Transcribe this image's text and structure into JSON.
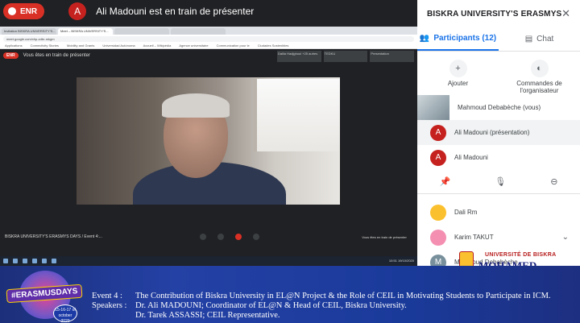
{
  "topbar": {
    "rec_label": "ENR",
    "presenter_initial": "A",
    "presenter_text": "Ali Madouni est en train de présenter"
  },
  "shared_screen": {
    "tabs": [
      "Invitation BISKRA UNIVERSITY'S...",
      "Meet – BISKRA UNIVERSITY'S...",
      "",
      ""
    ],
    "address": "meet.google.com/xhp-zdbr-mkgm",
    "bookmarks": [
      "Applications",
      "Connectivity Stories",
      "Mobility and Grants",
      "Universidad Autónoma",
      "Accueil – Wikipédia",
      "Agence universitaire",
      "Communication pour le",
      "Ciudades Sostenibles"
    ],
    "inner_rec": "ENR",
    "inner_presenting": "Vous êtes en train de présenter",
    "inner_tiles": [
      "Dalila Hadjghoul  +25 autres",
      "TEDKU",
      "Presentation"
    ],
    "bottom_title": "BISKRA UNIVERSITY'S ERASMYS DAYS / Event 4:...",
    "bottom_right": "Vous êtes en train de présenter",
    "taskbar_time": "10:51  19/10/2020"
  },
  "panel": {
    "title": "BISKRA UNIVERSITY'S ERASMYS D...",
    "tab_participants": "Participants (12)",
    "tab_chat": "Chat",
    "action_add": "Ajouter",
    "action_host": "Commandes de l'organisateur",
    "participants": [
      {
        "name": "Mahmoud Debabèche (vous)",
        "initial": "",
        "color": "#9e9e9e"
      },
      {
        "name": "Ali Madouni (présentation)",
        "initial": "A",
        "color": "#c5221f"
      },
      {
        "name": "Ali Madouni",
        "initial": "A",
        "color": "#c5221f"
      }
    ],
    "participants2": [
      {
        "name": "Dali Rm",
        "initial": "",
        "color": "#fbc02d"
      },
      {
        "name": "Karim TAKUT",
        "initial": "",
        "color": "#f48fb1"
      },
      {
        "name": "Mahmoud Debabèche",
        "initial": "M",
        "color": "#78909c"
      }
    ]
  },
  "university": {
    "top": "UNIVERSITÉ DE BISKRA",
    "main": "MOHAMED KHIDER"
  },
  "banner": {
    "logo_text": "#ERASMUSDAYS",
    "logo_date": "15-16-17 of october 2020",
    "event_label": "Event 4 :",
    "event_text": "The Contribution of Biskra University in EL@N Project & the Role of CEIL in Motivating Students to Participate in ICM.",
    "speakers_label": "Speakers :",
    "speaker1": "Dr. Ali MADOUNI; Coordinator of EL@N & Head of CEIL, Biskra University.",
    "speaker2": "Dr. Tarek ASSASSI; CEIL Representative."
  }
}
